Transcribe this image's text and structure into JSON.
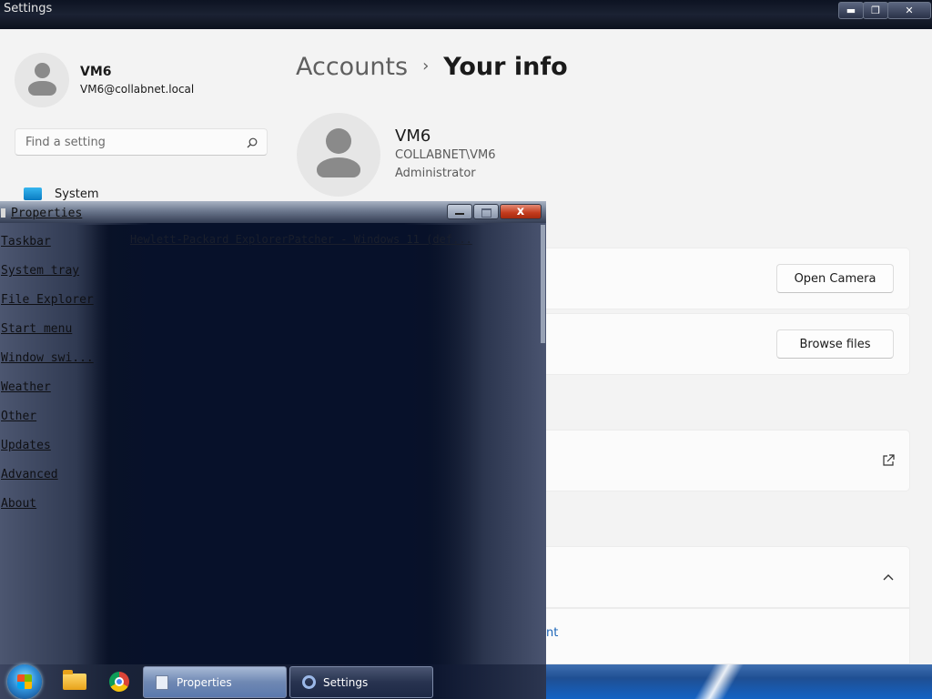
{
  "settings": {
    "window_title": "Settings",
    "controls": {
      "minimize": "▬",
      "maximize": "❐",
      "close": "✕"
    },
    "user": {
      "name": "VM6",
      "email": "VM6@collabnet.local"
    },
    "search": {
      "placeholder": "Find a setting"
    },
    "nav": {
      "system_label": "System"
    },
    "breadcrumb": {
      "parent": "Accounts",
      "current": "Your info"
    },
    "profile": {
      "name": "VM6",
      "domain": "COLLABNET\\VM6",
      "role": "Administrator"
    },
    "buttons": {
      "open_camera": "Open Camera",
      "browse_files": "Browse files"
    },
    "link_fragment": "nt"
  },
  "properties_window": {
    "title": "Properties",
    "close_glyph": "x",
    "header_link": "Hewlett-Packard ExplorerPatcher - Windows 11 (def...",
    "links": [
      "Taskbar",
      "System tray",
      "File Explorer",
      "Start menu",
      "Window swi...",
      "Weather",
      "Other",
      "Updates",
      "Advanced",
      "About"
    ]
  },
  "taskbar": {
    "tasks": [
      {
        "label": "Properties"
      },
      {
        "label": "Settings"
      }
    ]
  },
  "colors": {
    "accent": "#1a64b7",
    "close_red": "#c23a1c",
    "taskbar_blue": "#1f4f93"
  }
}
